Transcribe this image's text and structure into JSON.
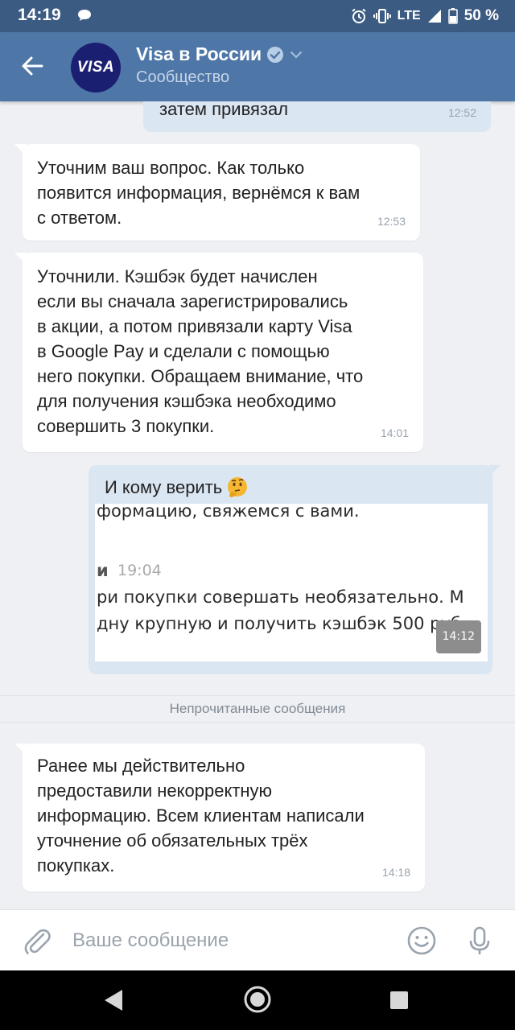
{
  "status_bar": {
    "time": "14:19",
    "network": "LTE",
    "battery": "50 %"
  },
  "header": {
    "back_icon": "arrow-left-icon",
    "avatar_text": "VISA",
    "title": "Visa в России",
    "verified_icon": "verified-check-icon",
    "dropdown_icon": "chevron-down-icon",
    "subtitle": "Сообщество"
  },
  "messages": [
    {
      "direction": "out",
      "text": "затем привязал",
      "time": "12:52"
    },
    {
      "direction": "in",
      "text": "Уточним ваш вопрос. Как только\nпоявится информация, вернёмся к вам\nс ответом.",
      "time": "12:53"
    },
    {
      "direction": "in",
      "text": "Уточнили. Кэшбэк будет начислен\nесли вы сначала зарегистрировались\nв акции, а потом привязали карту Visa\nв Google Pay и сделали с помощью\nнего покупки. Обращаем внимание, что\nдля получения кэшбэка необходимо\nсовершить 3 покупки.",
      "time": "14:01"
    },
    {
      "direction": "out",
      "text": "И кому верить",
      "emoji": "thinking-face-emoji",
      "image": {
        "line1": "формацию, свяжемся с вами.",
        "sender": "и",
        "sender_time": "19:04",
        "line2": "ри покупки совершать необязательно. М",
        "line3": "дну крупную и получить кэшбэк 500 руб"
      },
      "time": "14:12"
    },
    {
      "direction": "in",
      "text": "Ранее мы действительно\nпредоставили некорректную\nинформацию. Всем клиентам написали\nуточнение об обязательных трёх\nпокупках.",
      "time": "14:18"
    }
  ],
  "unread_divider": "Непрочитанные сообщения",
  "composer": {
    "placeholder": "Ваше сообщение",
    "attach_icon": "paperclip-icon",
    "emoji_icon": "smiley-icon",
    "mic_icon": "microphone-icon"
  },
  "nav_bar": {
    "back_icon": "nav-back-icon",
    "home_icon": "nav-home-icon",
    "recents_icon": "nav-recents-icon"
  },
  "colors": {
    "header_bg": "#4e77a8",
    "status_bg": "#3c5b82",
    "bubble_in": "#ffffff",
    "bubble_out": "#dbe6f3",
    "chat_bg": "#eef0f3",
    "avatar_bg": "#1a1f71"
  }
}
